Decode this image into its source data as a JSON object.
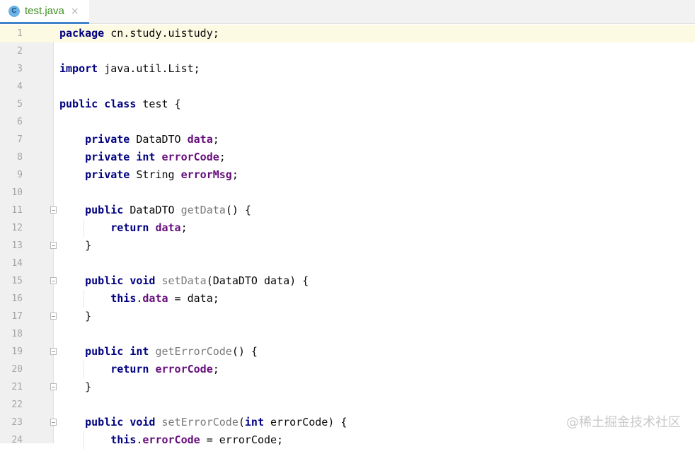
{
  "tab": {
    "icon_letter": "C",
    "label": "test.java",
    "close": "×"
  },
  "watermark": "@稀土掘金技术社区",
  "lines": [
    {
      "n": "1",
      "fold": false,
      "html": "<span class='kw'>package</span> cn.study.uistudy;"
    },
    {
      "n": "2",
      "fold": false,
      "html": ""
    },
    {
      "n": "3",
      "fold": false,
      "html": "<span class='kw'>import</span> java.util.List;"
    },
    {
      "n": "4",
      "fold": false,
      "html": ""
    },
    {
      "n": "5",
      "fold": false,
      "html": "<span class='kw'>public class</span> test {"
    },
    {
      "n": "6",
      "fold": false,
      "html": ""
    },
    {
      "n": "7",
      "fold": false,
      "html": "    <span class='kw'>private</span> DataDTO <span class='fld'>data</span>;"
    },
    {
      "n": "8",
      "fold": false,
      "html": "    <span class='kw'>private int</span> <span class='fld'>errorCode</span>;"
    },
    {
      "n": "9",
      "fold": false,
      "html": "    <span class='kw'>private</span> String <span class='fld'>errorMsg</span>;"
    },
    {
      "n": "10",
      "fold": false,
      "html": ""
    },
    {
      "n": "11",
      "fold": true,
      "html": "    <span class='kw'>public</span> DataDTO <span class='mth'>getData</span>() {"
    },
    {
      "n": "12",
      "fold": false,
      "html": "        <span class='kw'>return</span> <span class='fld'>data</span>;"
    },
    {
      "n": "13",
      "fold": true,
      "html": "    }"
    },
    {
      "n": "14",
      "fold": false,
      "html": ""
    },
    {
      "n": "15",
      "fold": true,
      "html": "    <span class='kw'>public void</span> <span class='mth'>setData</span>(DataDTO data) {"
    },
    {
      "n": "16",
      "fold": false,
      "html": "        <span class='kw'>this</span>.<span class='fld'>data</span> = data;"
    },
    {
      "n": "17",
      "fold": true,
      "html": "    }"
    },
    {
      "n": "18",
      "fold": false,
      "html": ""
    },
    {
      "n": "19",
      "fold": true,
      "html": "    <span class='kw'>public int</span> <span class='mth'>getErrorCode</span>() {"
    },
    {
      "n": "20",
      "fold": false,
      "html": "        <span class='kw'>return</span> <span class='fld'>errorCode</span>;"
    },
    {
      "n": "21",
      "fold": true,
      "html": "    }"
    },
    {
      "n": "22",
      "fold": false,
      "html": ""
    },
    {
      "n": "23",
      "fold": true,
      "html": "    <span class='kw'>public void</span> <span class='mth'>setErrorCode</span>(<span class='kw'>int</span> errorCode) {"
    },
    {
      "n": "24",
      "fold": false,
      "html": "        <span class='kw'>this</span>.<span class='fld'>errorCode</span> = errorCode;"
    }
  ]
}
